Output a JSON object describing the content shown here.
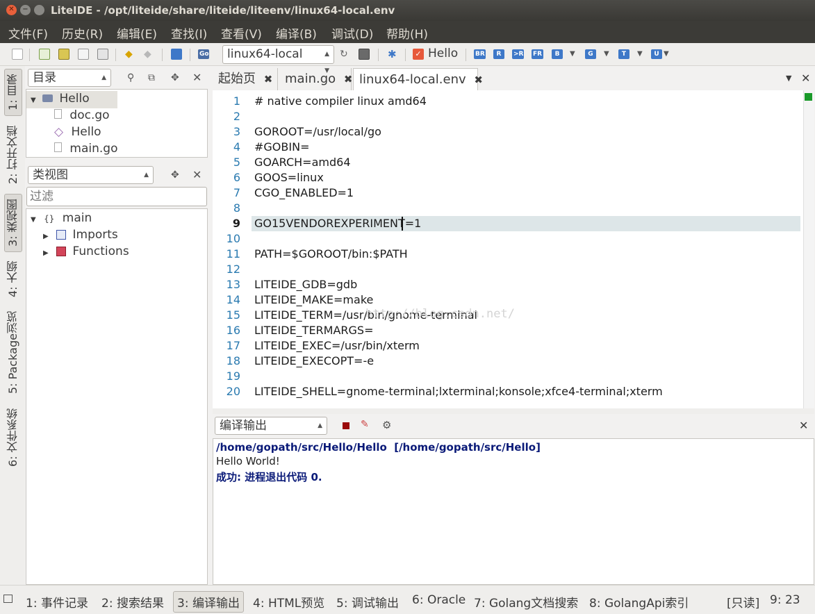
{
  "window": {
    "title": "LiteIDE - /opt/liteide/share/liteide/liteenv/linux64-local.env"
  },
  "menu": [
    "文件(F)",
    "历史(R)",
    "编辑(E)",
    "查找(I)",
    "查看(V)",
    "编译(B)",
    "调试(D)",
    "帮助(H)"
  ],
  "toolbar": {
    "env_select": "linux64-local",
    "run_target": "Hello",
    "build_buttons": [
      "BR",
      "R",
      "&gt;R",
      "FR",
      "B",
      "G",
      "T",
      "U"
    ]
  },
  "side_tabs": [
    "1: 目录",
    "2: 打开文档",
    "3: 类视图",
    "4: 大纲",
    "5: Package浏览",
    "6: 文件系统"
  ],
  "dir_panel": {
    "combo": "目录",
    "items": [
      {
        "label": "Hello",
        "type": "folder"
      },
      {
        "label": "doc.go",
        "type": "file"
      },
      {
        "label": "Hello",
        "type": "pkg"
      },
      {
        "label": "main.go",
        "type": "file"
      }
    ]
  },
  "class_panel": {
    "combo": "类视图",
    "filter_placeholder": "过滤",
    "items": [
      {
        "label": "main",
        "icon": "{}"
      },
      {
        "label": "Imports"
      },
      {
        "label": "Functions"
      }
    ]
  },
  "editor": {
    "tabs": [
      {
        "label": "起始页"
      },
      {
        "label": "main.go"
      },
      {
        "label": "linux64-local.env",
        "active": true
      }
    ],
    "current_line": 9,
    "lines": [
      {
        "n": "1",
        "text": "# native compiler linux amd64"
      },
      {
        "n": "2",
        "text": ""
      },
      {
        "n": "3",
        "text": "GOROOT=/usr/local/go"
      },
      {
        "n": "4",
        "text": "#GOBIN="
      },
      {
        "n": "5",
        "text": "GOARCH=amd64"
      },
      {
        "n": "6",
        "text": "GOOS=linux"
      },
      {
        "n": "7",
        "text": "CGO_ENABLED=1"
      },
      {
        "n": "8",
        "text": ""
      },
      {
        "n": "9",
        "text": "GO15VENDOREXPERIMENT=1"
      },
      {
        "n": "10",
        "text": ""
      },
      {
        "n": "11",
        "text": "PATH=$GOROOT/bin:$PATH"
      },
      {
        "n": "12",
        "text": ""
      },
      {
        "n": "13",
        "text": "LITEIDE_GDB=gdb"
      },
      {
        "n": "14",
        "text": "LITEIDE_MAKE=make"
      },
      {
        "n": "15",
        "text": "LITEIDE_TERM=/usr/bin/gnome-terminal"
      },
      {
        "n": "16",
        "text": "LITEIDE_TERMARGS="
      },
      {
        "n": "17",
        "text": "LITEIDE_EXEC=/usr/bin/xterm"
      },
      {
        "n": "18",
        "text": "LITEIDE_EXECOPT=-e"
      },
      {
        "n": "19",
        "text": ""
      },
      {
        "n": "20",
        "text": "LITEIDE_SHELL=gnome-terminal;lxterminal;konsole;xfce4-terminal;xterm"
      }
    ],
    "watermark": "http://blog.csdn.net/"
  },
  "output": {
    "combo": "编译输出",
    "lines": [
      "/home/gopath/src/Hello/Hello  [/home/gopath/src/Hello]",
      "Hello World!",
      "成功: 进程退出代码 0."
    ]
  },
  "statusbar": {
    "tabs": [
      "1: 事件记录",
      "2: 搜索结果",
      "3: 编译输出",
      "4: HTML预览",
      "5: 调试输出",
      "6: Oracle",
      "7: Golang文档搜索",
      "8: GolangApi索引"
    ],
    "mode": "[只读]",
    "position": "9: 23"
  },
  "colors": {
    "titlebar": "#3c3b37",
    "line_numbers": "#2a7ab0",
    "current_line": "#dde6e8",
    "output_bold": "#0a1a78"
  }
}
